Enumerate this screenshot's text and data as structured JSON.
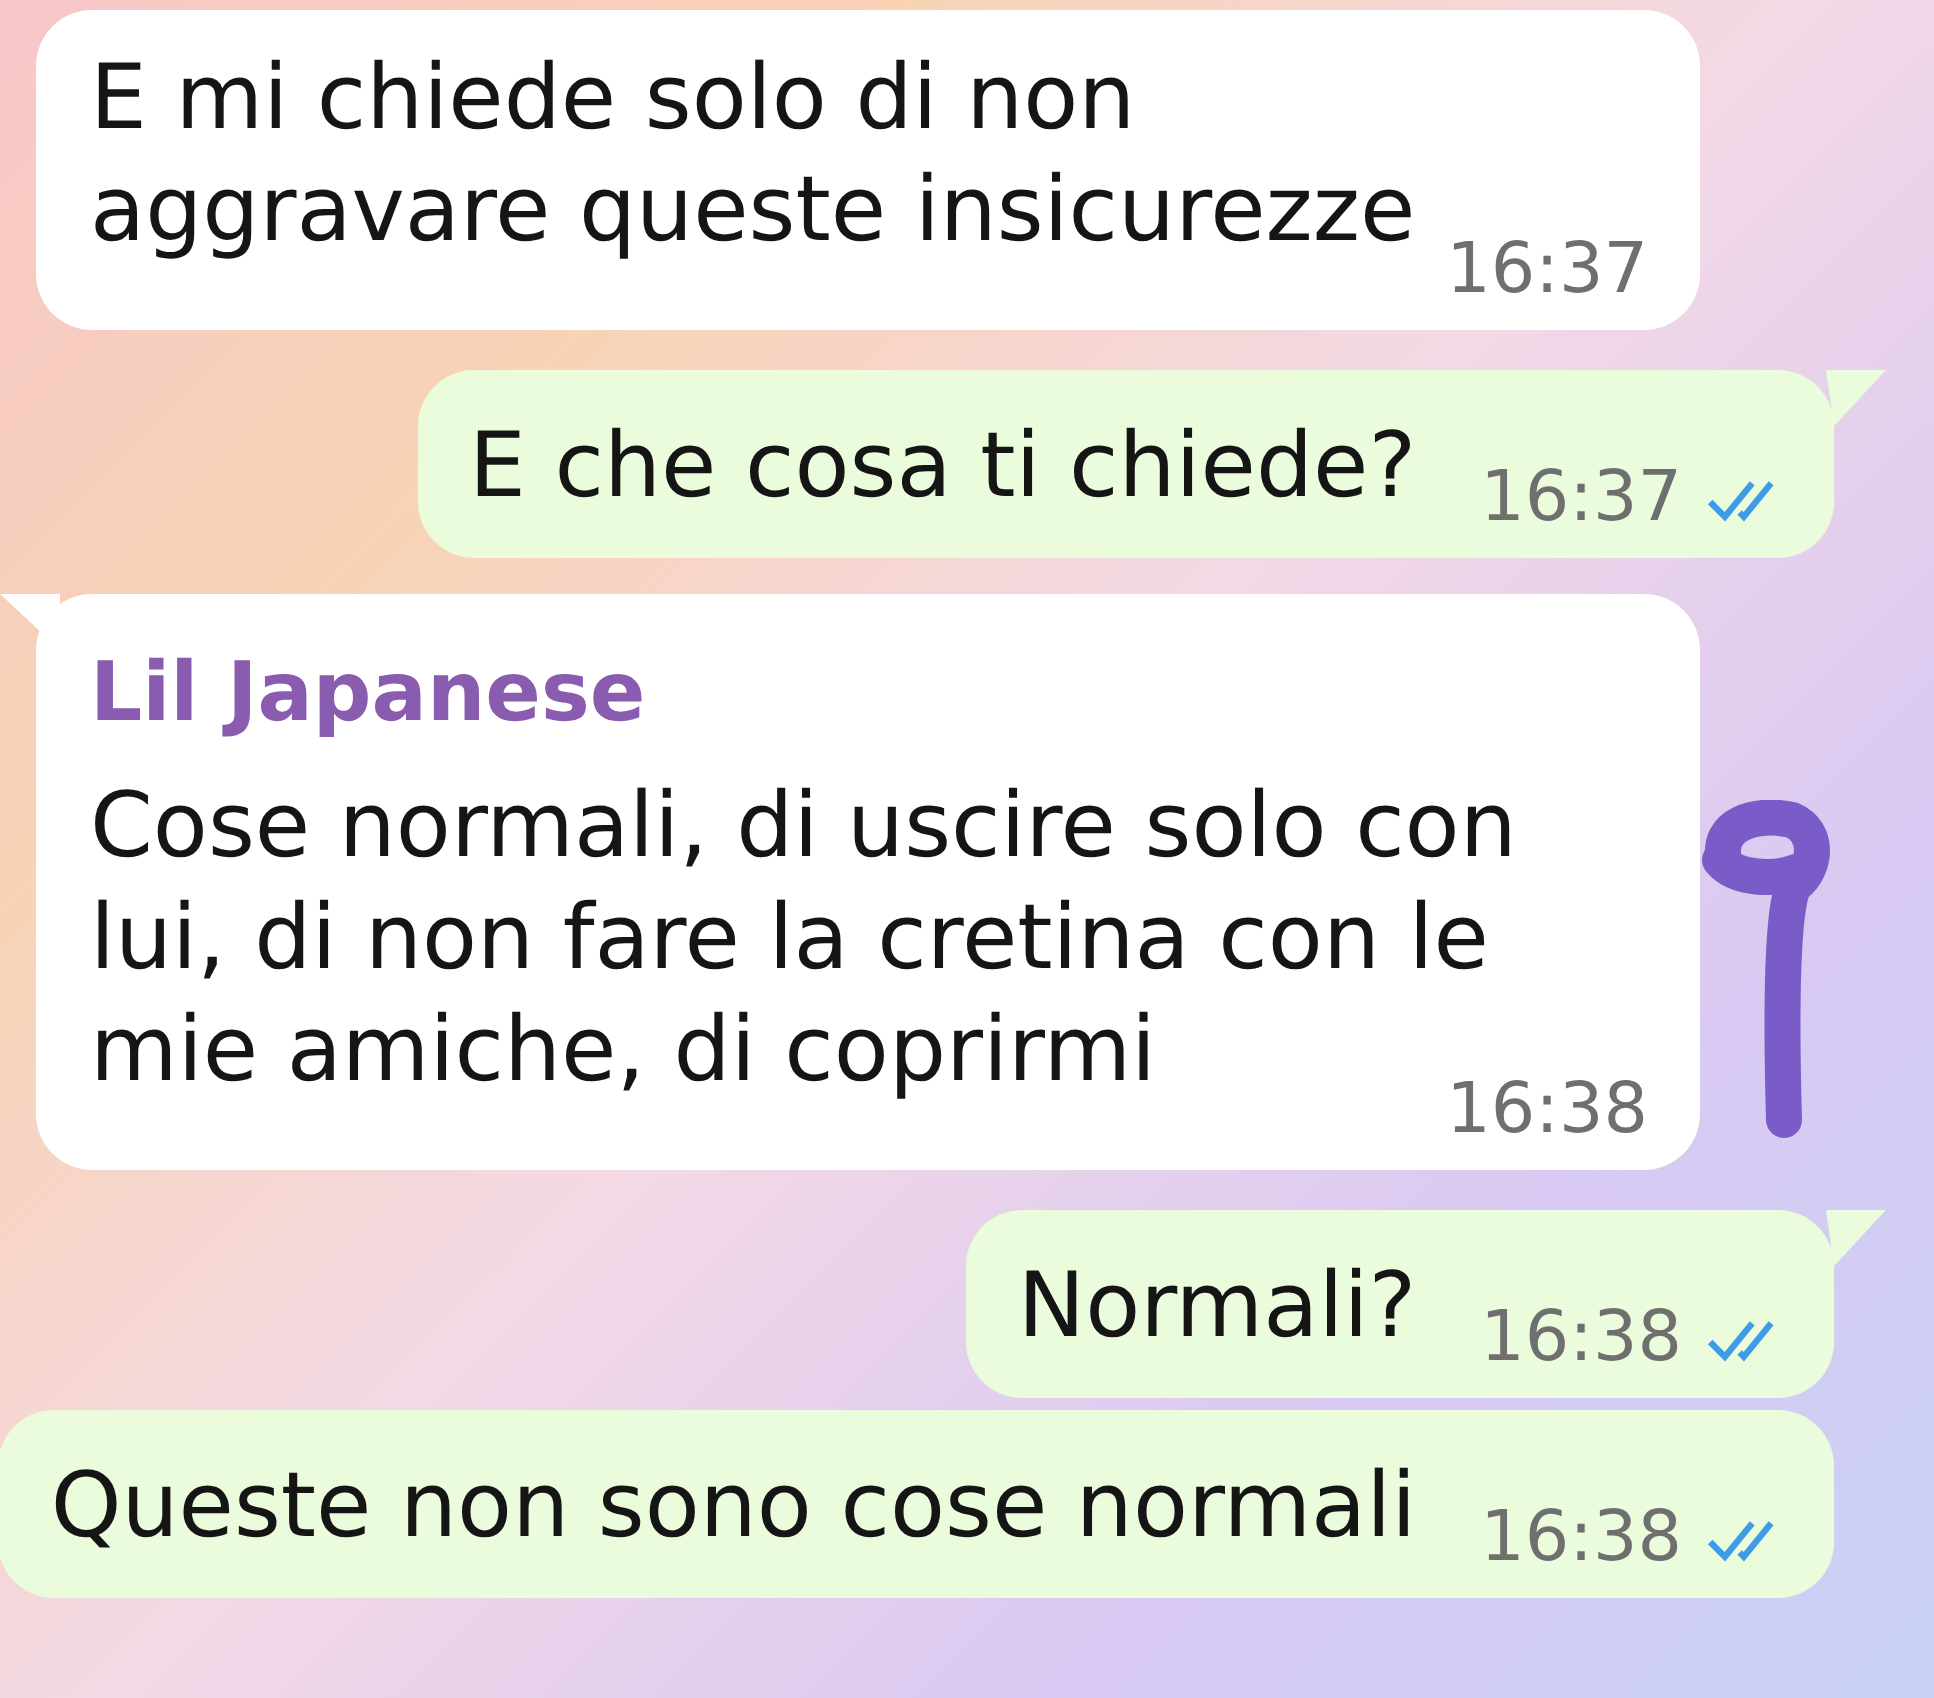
{
  "messages": [
    {
      "outgoing": false,
      "tail": false,
      "text": "E mi chiede solo di non aggravare queste insicurezze",
      "time": "16:37"
    },
    {
      "outgoing": true,
      "tail": true,
      "text": "E che cosa ti chiede?",
      "time": "16:37",
      "read": true
    },
    {
      "outgoing": false,
      "tail": true,
      "sender": "Lil Japanese",
      "text": "Cose normali, di uscire solo con lui, di non fare la cretina con le mie amiche, di coprirmi",
      "time": "16:38"
    },
    {
      "outgoing": true,
      "tail": true,
      "text": "Normali?",
      "time": "16:38",
      "read": true
    },
    {
      "outgoing": true,
      "tail": false,
      "text": "Queste non sono cose normali",
      "time": "16:38",
      "read": true
    }
  ]
}
